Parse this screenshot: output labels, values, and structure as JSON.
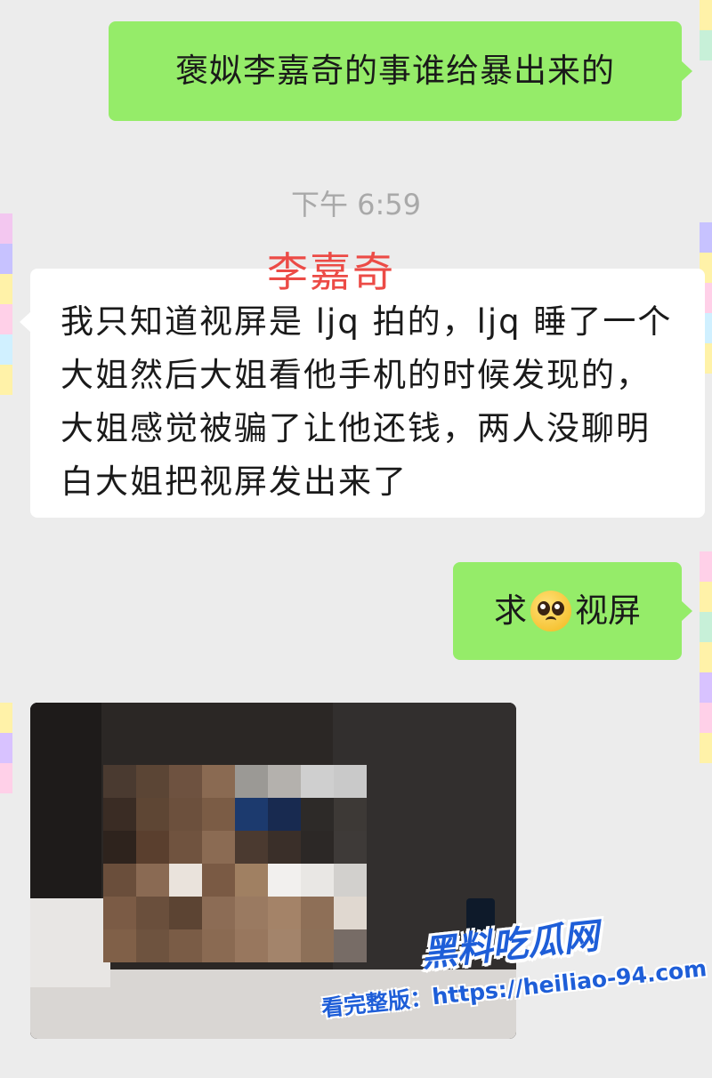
{
  "messages": {
    "outgoing_1": "褒姒李嘉奇的事谁给暴出来的",
    "timestamp": "下午 6:59",
    "sender_tag": "李嘉奇",
    "incoming_1": "我只知道视屏是 ljq 拍的，ljq 睡了一个大姐然后大姐看他手机的时候发现的，大姐感觉被骗了让他还钱，两人没聊明白大姐把视屏发出来了",
    "outgoing_2_before": "求",
    "outgoing_2_emoji": "pleading-face",
    "outgoing_2_after": "视屏"
  },
  "photo": {
    "content": "pixelated-image"
  },
  "watermark": {
    "brand": "黑料吃瓜网",
    "line": "看完整版：https://heiliao-94.com"
  },
  "colors": {
    "outgoing_bubble": "#95ec69",
    "incoming_bubble": "#ffffff",
    "background": "#ececec",
    "timestamp": "#a9a9a9",
    "sender_tag": "#ec4b46",
    "watermark_blue": "#1e5ed8"
  }
}
